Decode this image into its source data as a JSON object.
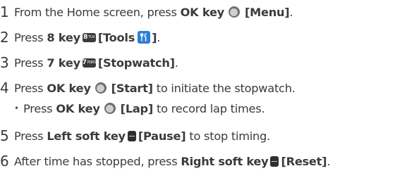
{
  "steps": [
    {
      "number": "1",
      "text_before": "From the Home screen, press",
      "key": "OK key",
      "label": "[Menu]",
      "text_after": "."
    },
    {
      "number": "2",
      "text_before": "Press",
      "key": "8 key",
      "key_digit": "8",
      "key_letters": "TUV",
      "label": "[Tools",
      "label_close": "]",
      "text_after": "."
    },
    {
      "number": "3",
      "text_before": "Press",
      "key": "7 key",
      "key_digit": "7",
      "key_letters": "PQRS",
      "label": "[Stopwatch]",
      "text_after": "."
    },
    {
      "number": "4",
      "text_before": "Press",
      "key": "OK key",
      "label": "[Start]",
      "text_after": "to initiate the stopwatch."
    },
    {
      "bullet": "•",
      "text_before": "Press",
      "key": "OK key",
      "label": "[Lap]",
      "text_after": "to record lap times."
    },
    {
      "number": "5",
      "text_before": "Press",
      "key": "Left soft key",
      "label": "[Pause]",
      "text_after": "to stop timing."
    },
    {
      "number": "6",
      "text_before": "After time has stopped, press",
      "key": "Right soft key",
      "label": "[Reset]",
      "text_after": "."
    }
  ],
  "icons": {
    "ok_key": "ok-key-icon",
    "num_key": "number-key-icon",
    "tools": "tools-app-icon",
    "soft_key": "soft-key-icon",
    "tools_color": "#2e7fd6"
  }
}
